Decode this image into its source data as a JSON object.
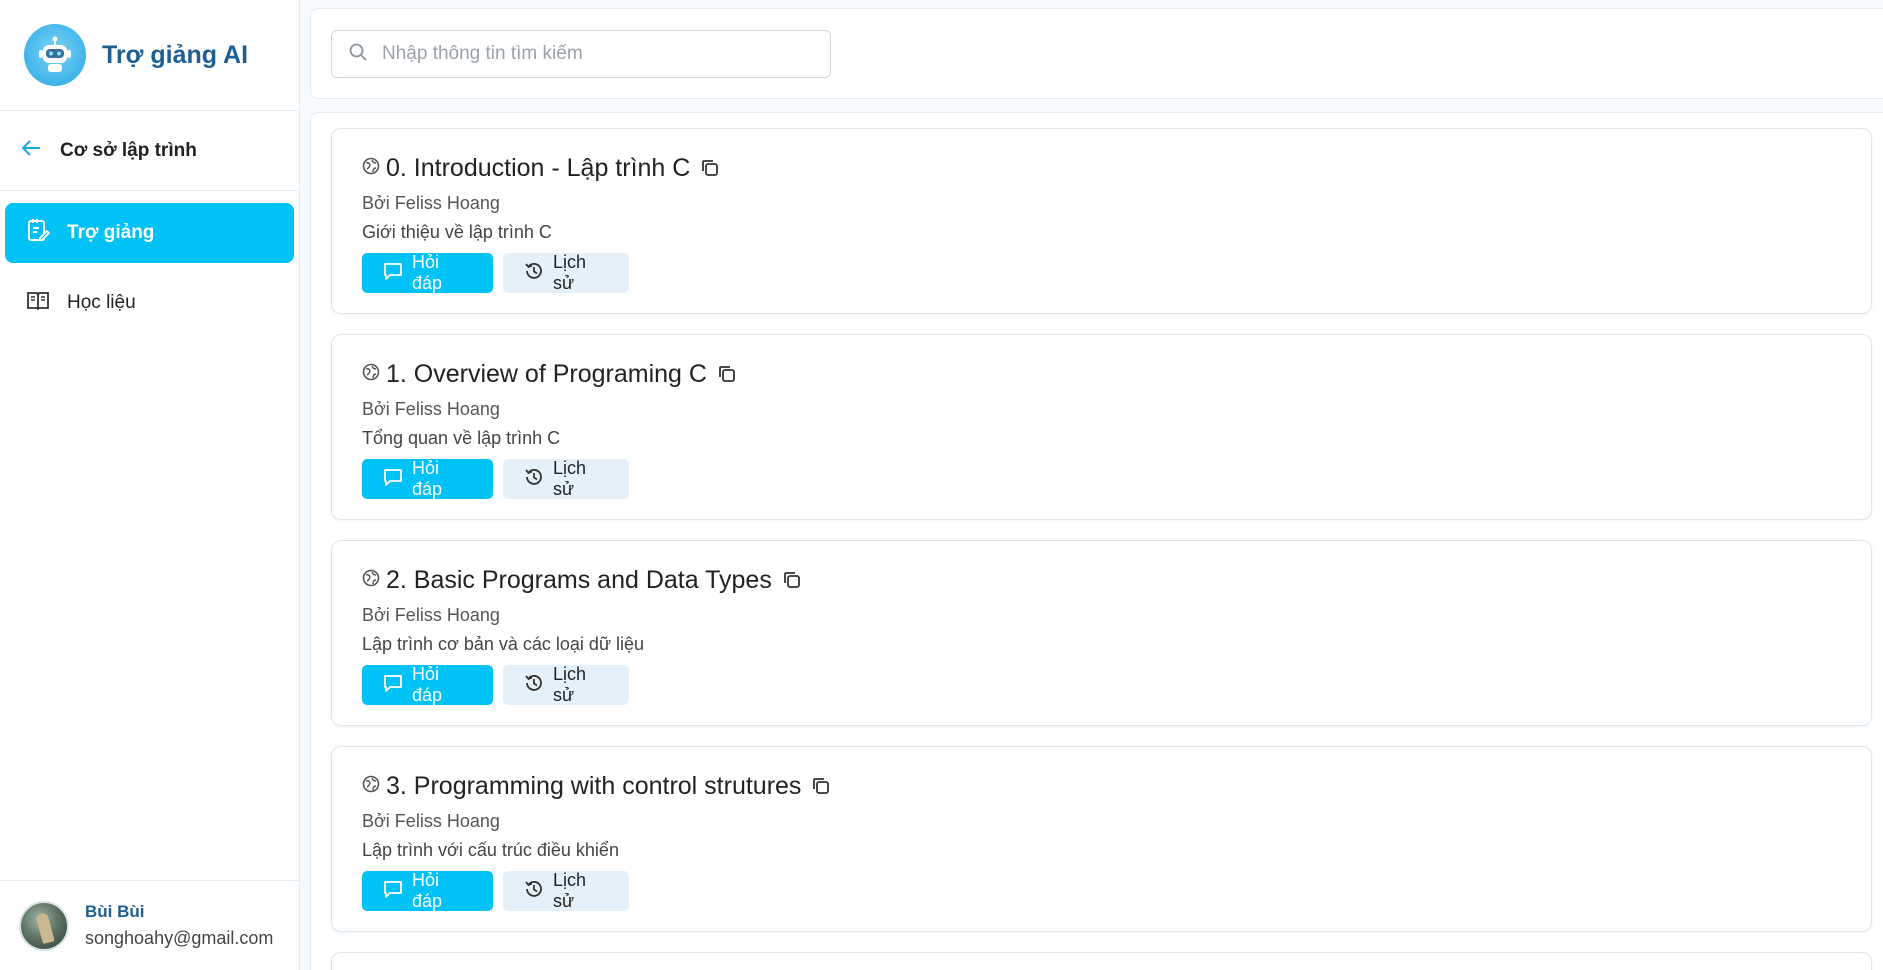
{
  "app": {
    "title": "Trợ giảng AI"
  },
  "sidebar": {
    "back_label": "Cơ sở lập trình",
    "items": [
      {
        "label": "Trợ giảng",
        "icon": "edit-note-icon",
        "active": true
      },
      {
        "label": "Học liệu",
        "icon": "open-book-icon",
        "active": false
      }
    ]
  },
  "user": {
    "name": "Bùi Bùi",
    "email": "songhoahy@gmail.com"
  },
  "search": {
    "placeholder": "Nhập thông tin tìm kiếm",
    "value": ""
  },
  "cards": [
    {
      "title": "0. Introduction - Lập trình C",
      "author": "Bởi Feliss Hoang",
      "description": "Giới thiệu về lập trình C",
      "ask_label": "Hỏi đáp",
      "history_label": "Lịch sử"
    },
    {
      "title": "1. Overview of Programing C",
      "author": "Bởi Feliss Hoang",
      "description": "Tổng quan về lập trình C",
      "ask_label": "Hỏi đáp",
      "history_label": "Lịch sử"
    },
    {
      "title": "2. Basic Programs and Data Types",
      "author": "Bởi Feliss Hoang",
      "description": "Lập trình cơ bản và các loại dữ liệu",
      "ask_label": "Hỏi đáp",
      "history_label": "Lịch sử"
    },
    {
      "title": "3. Programming with control strutures",
      "author": "Bởi Feliss Hoang",
      "description": "Lập trình với cấu trúc điều khiển",
      "ask_label": "Hỏi đáp",
      "history_label": "Lịch sử"
    }
  ],
  "colors": {
    "accent": "#00c2f7",
    "brand": "#1c5f94",
    "secondary_button": "#e4f1fb"
  }
}
